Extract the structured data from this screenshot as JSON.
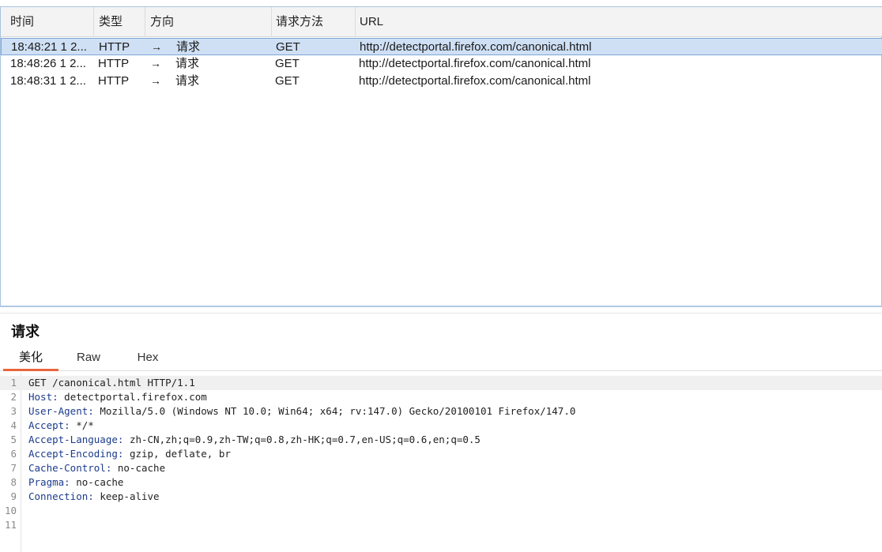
{
  "table": {
    "columns": [
      "时间",
      "类型",
      "方向",
      "请求方法",
      "URL"
    ],
    "rows": [
      {
        "time": "18:48:21 1 2...",
        "type": "HTTP",
        "arrow": "→",
        "direction": "请求",
        "method": "GET",
        "url": "http://detectportal.firefox.com/canonical.html"
      },
      {
        "time": "18:48:26 1 2...",
        "type": "HTTP",
        "arrow": "→",
        "direction": "请求",
        "method": "GET",
        "url": "http://detectportal.firefox.com/canonical.html"
      },
      {
        "time": "18:48:31 1 2...",
        "type": "HTTP",
        "arrow": "→",
        "direction": "请求",
        "method": "GET",
        "url": "http://detectportal.firefox.com/canonical.html"
      }
    ],
    "selected_row": 0
  },
  "detail": {
    "title": "请求",
    "tabs": [
      "美化",
      "Raw",
      "Hex"
    ],
    "active_tab": 0,
    "lines": [
      {
        "n": "1",
        "key": "",
        "value": "GET /canonical.html HTTP/1.1"
      },
      {
        "n": "2",
        "key": "Host:",
        "value": " detectportal.firefox.com"
      },
      {
        "n": "3",
        "key": "User-Agent:",
        "value": " Mozilla/5.0 (Windows NT 10.0; Win64; x64; rv:147.0) Gecko/20100101 Firefox/147.0"
      },
      {
        "n": "4",
        "key": "Accept:",
        "value": " */*"
      },
      {
        "n": "5",
        "key": "Accept-Language:",
        "value": " zh-CN,zh;q=0.9,zh-TW;q=0.8,zh-HK;q=0.7,en-US;q=0.6,en;q=0.5"
      },
      {
        "n": "6",
        "key": "Accept-Encoding:",
        "value": " gzip, deflate, br"
      },
      {
        "n": "7",
        "key": "Cache-Control:",
        "value": " no-cache"
      },
      {
        "n": "8",
        "key": "Pragma:",
        "value": " no-cache"
      },
      {
        "n": "9",
        "key": "Connection:",
        "value": " keep-alive"
      },
      {
        "n": "10",
        "key": "",
        "value": ""
      },
      {
        "n": "11",
        "key": "",
        "value": ""
      }
    ]
  },
  "colors": {
    "accent_tab": "#e8663b",
    "selected_row_bg": "#cfe0f5",
    "header_key": "#1b3b8c"
  }
}
